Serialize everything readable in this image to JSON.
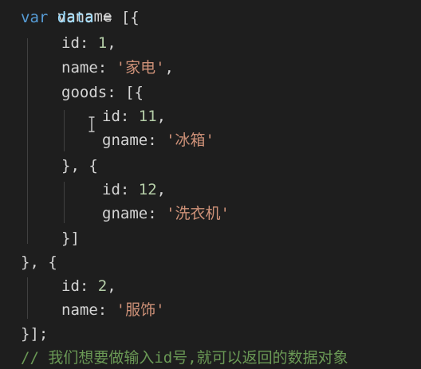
{
  "editor": {
    "top_partial_text": "vaname",
    "colors": {
      "background": "#1e1e1e",
      "keyword": "#569cd6",
      "variable": "#9cdcfe",
      "punctuation": "#d4d4d4",
      "number": "#b5cea8",
      "string": "#ce9178",
      "comment": "#6a9955",
      "indent_guide": "#404040"
    },
    "lines": [
      [
        {
          "t": "var",
          "c": "c-kw"
        },
        {
          "t": " ",
          "c": "c-punc"
        },
        {
          "t": "data",
          "c": "c-var"
        },
        {
          "t": " = [{",
          "c": "c-punc"
        }
      ],
      [
        {
          "t": "id",
          "c": "c-prop"
        },
        {
          "t": ": ",
          "c": "c-punc"
        },
        {
          "t": "1",
          "c": "c-num"
        },
        {
          "t": ",",
          "c": "c-punc"
        }
      ],
      [
        {
          "t": "name",
          "c": "c-prop"
        },
        {
          "t": ": ",
          "c": "c-punc"
        },
        {
          "t": "'家电'",
          "c": "c-str"
        },
        {
          "t": ",",
          "c": "c-punc"
        }
      ],
      [
        {
          "t": "goods",
          "c": "c-prop"
        },
        {
          "t": ": [{",
          "c": "c-punc"
        }
      ],
      [
        {
          "t": "id",
          "c": "c-prop"
        },
        {
          "t": ": ",
          "c": "c-punc"
        },
        {
          "t": "11",
          "c": "c-num"
        },
        {
          "t": ",",
          "c": "c-punc"
        }
      ],
      [
        {
          "t": "gname",
          "c": "c-prop"
        },
        {
          "t": ": ",
          "c": "c-punc"
        },
        {
          "t": "'冰箱'",
          "c": "c-str"
        }
      ],
      [
        {
          "t": "}, {",
          "c": "c-punc"
        }
      ],
      [
        {
          "t": "id",
          "c": "c-prop"
        },
        {
          "t": ": ",
          "c": "c-punc"
        },
        {
          "t": "12",
          "c": "c-num"
        },
        {
          "t": ",",
          "c": "c-punc"
        }
      ],
      [
        {
          "t": "gname",
          "c": "c-prop"
        },
        {
          "t": ": ",
          "c": "c-punc"
        },
        {
          "t": "'洗衣机'",
          "c": "c-str"
        }
      ],
      [
        {
          "t": "}]",
          "c": "c-punc"
        }
      ],
      [
        {
          "t": "}, {",
          "c": "c-punc"
        }
      ],
      [
        {
          "t": "id",
          "c": "c-prop"
        },
        {
          "t": ": ",
          "c": "c-punc"
        },
        {
          "t": "2",
          "c": "c-num"
        },
        {
          "t": ",",
          "c": "c-punc"
        }
      ],
      [
        {
          "t": "name",
          "c": "c-prop"
        },
        {
          "t": ": ",
          "c": "c-punc"
        },
        {
          "t": "'服饰'",
          "c": "c-str"
        }
      ],
      [
        {
          "t": "}];",
          "c": "c-punc"
        }
      ],
      [
        {
          "t": "// 我们想要做输入id号,就可以返回的数据对象",
          "c": "c-com"
        }
      ]
    ]
  }
}
